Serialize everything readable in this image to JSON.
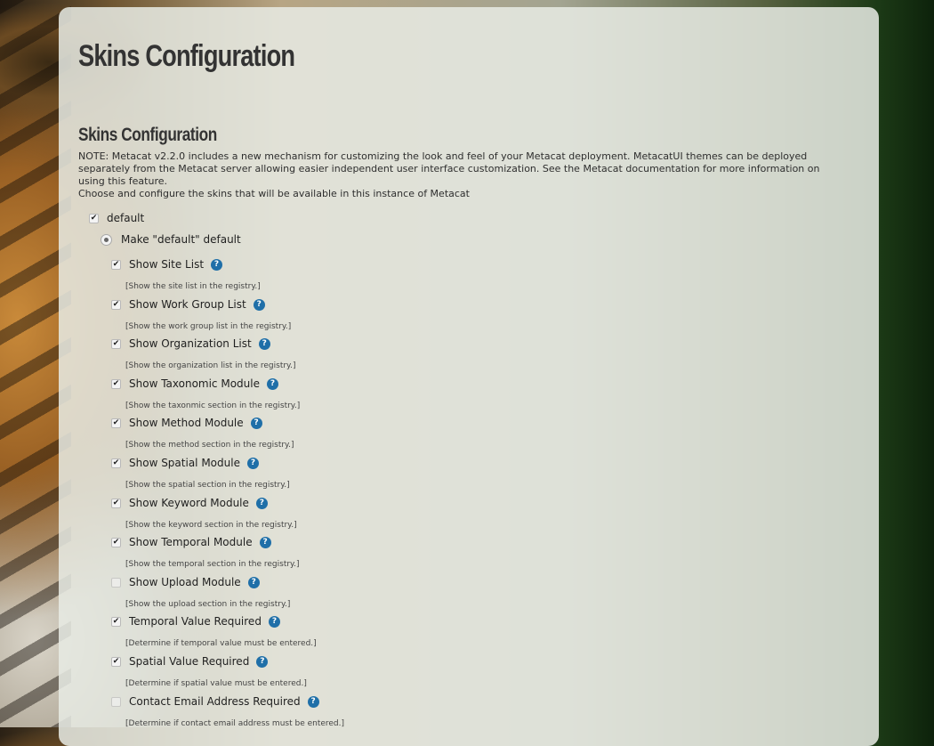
{
  "page": {
    "title": "Skins Configuration",
    "section_title": "Skins Configuration",
    "note": "NOTE: Metacat v2.2.0 includes a new mechanism for customizing the look and feel of your Metacat deployment. MetacatUI themes can be deployed separately from the Metacat server allowing easier independent user interface customization. See the Metacat documentation for more information on using this feature.",
    "choose_text": "Choose and configure the skins that will be available in this instance of Metacat"
  },
  "skin": {
    "name": "default",
    "checked": true,
    "make_default_label": "Make \"default\" default",
    "make_default_selected": true
  },
  "options": [
    {
      "label": "Show Site List",
      "checked": true,
      "description": "[Show the site list in the registry.]"
    },
    {
      "label": "Show Work Group List",
      "checked": true,
      "description": "[Show the work group list in the registry.]"
    },
    {
      "label": "Show Organization List",
      "checked": true,
      "description": "[Show the organization list in the registry.]"
    },
    {
      "label": "Show Taxonomic Module",
      "checked": true,
      "description": "[Show the taxonmic section in the registry.]"
    },
    {
      "label": "Show Method Module",
      "checked": true,
      "description": "[Show the method section in the registry.]"
    },
    {
      "label": "Show Spatial Module",
      "checked": true,
      "description": "[Show the spatial section in the registry.]"
    },
    {
      "label": "Show Keyword Module",
      "checked": true,
      "description": "[Show the keyword section in the registry.]"
    },
    {
      "label": "Show Temporal Module",
      "checked": true,
      "description": "[Show the temporal section in the registry.]"
    },
    {
      "label": "Show Upload Module",
      "checked": false,
      "description": "[Show the upload section in the registry.]"
    },
    {
      "label": "Temporal Value Required",
      "checked": true,
      "description": "[Determine if temporal value must be entered.]"
    },
    {
      "label": "Spatial Value Required",
      "checked": true,
      "description": "[Determine if spatial value must be entered.]"
    },
    {
      "label": "Contact Email Address Required",
      "checked": false,
      "description": "[Determine if contact email address must be entered.]"
    }
  ],
  "icons": {
    "checkbox_mark": "✔",
    "help": "?",
    "help_color": "#1f6fa8"
  }
}
